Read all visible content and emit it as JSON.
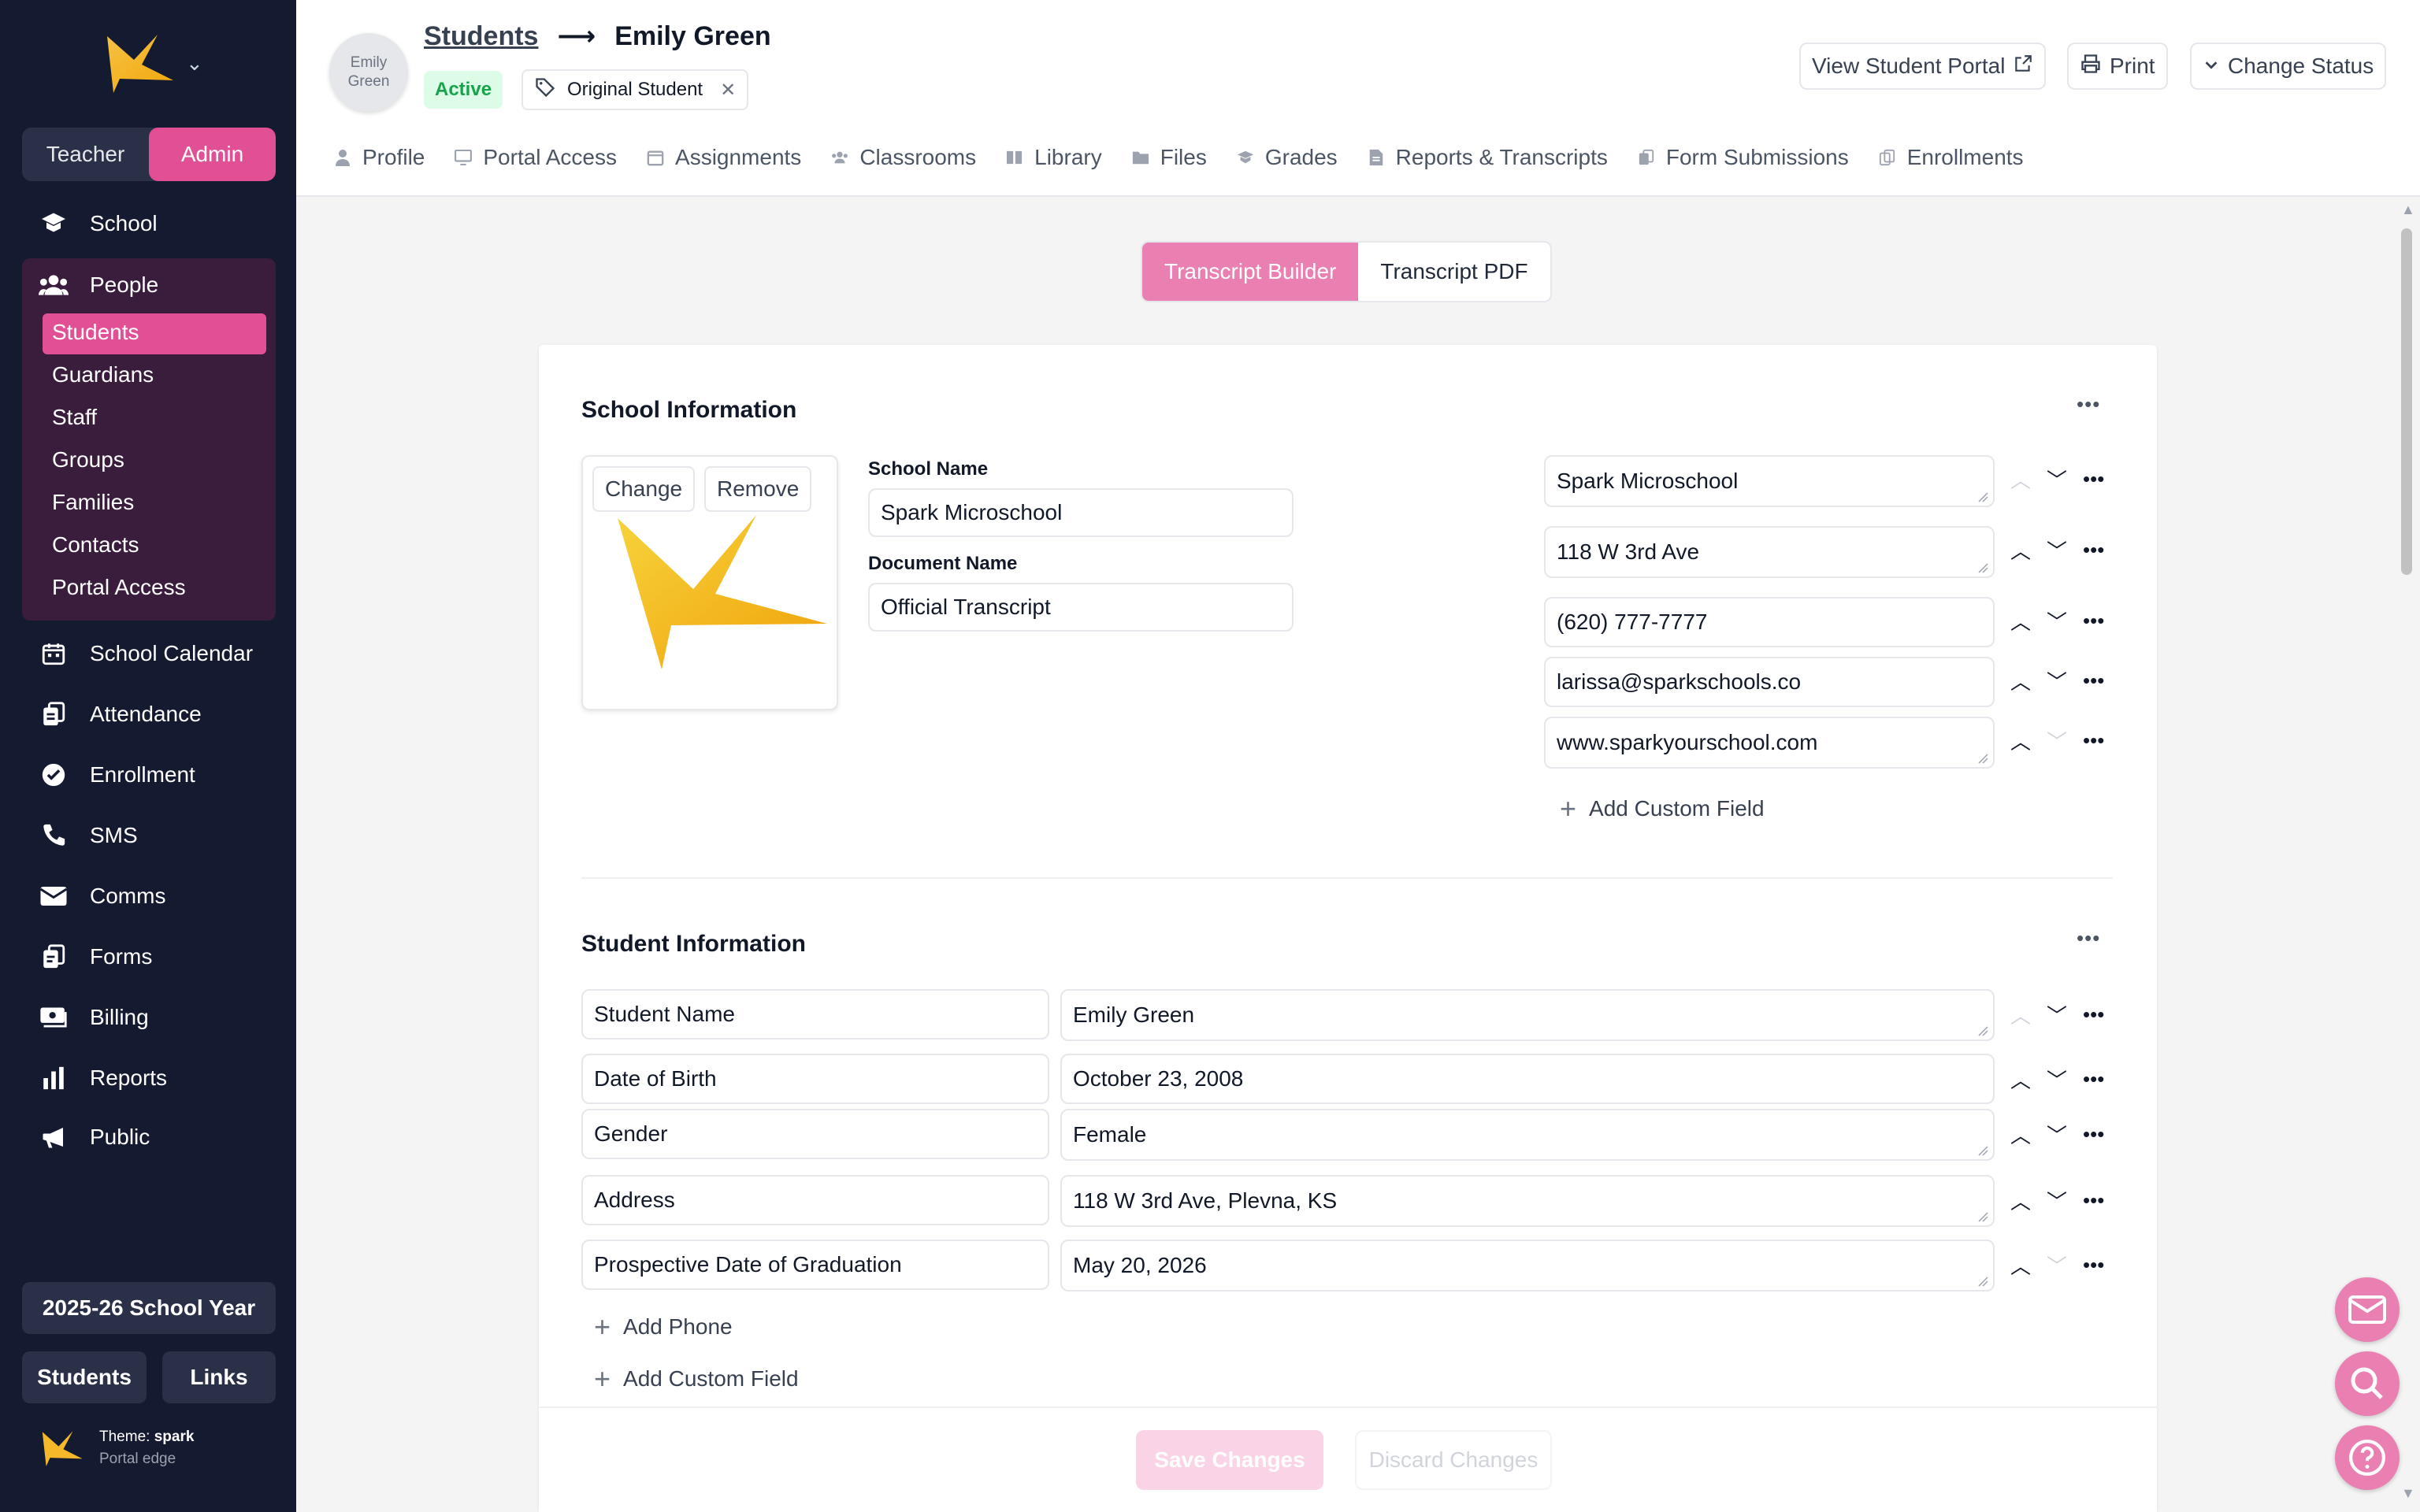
{
  "sidebar": {
    "roles": [
      "Teacher",
      "Admin"
    ],
    "active_role": "Admin",
    "nav_school": "School",
    "nav_people": "People",
    "people_sub": [
      "Students",
      "Guardians",
      "Staff",
      "Groups",
      "Families",
      "Contacts",
      "Portal Access"
    ],
    "nav_bottom": [
      "School Calendar",
      "Attendance",
      "Enrollment",
      "SMS",
      "Comms",
      "Forms",
      "Billing",
      "Reports",
      "Public"
    ],
    "year": "2025-26 School Year",
    "students_btn": "Students",
    "links_btn": "Links",
    "theme_label": "Theme:",
    "theme_name": "spark",
    "theme_sub": "Portal edge"
  },
  "header": {
    "avatar_text": "Emily Green",
    "crumb_link": "Students",
    "crumb_current": "Emily Green",
    "status": "Active",
    "tag": "Original Student",
    "view_portal": "View Student Portal",
    "print": "Print",
    "change_status": "Change Status",
    "tabs": [
      "Profile",
      "Portal Access",
      "Assignments",
      "Classrooms",
      "Library",
      "Files",
      "Grades",
      "Reports & Transcripts",
      "Form Submissions",
      "Enrollments"
    ]
  },
  "segment": {
    "builder": "Transcript Builder",
    "pdf": "Transcript PDF"
  },
  "school_info": {
    "title": "School Information",
    "change": "Change",
    "remove": "Remove",
    "school_name_label": "School Name",
    "school_name": "Spark Microschool",
    "document_name_label": "Document Name",
    "document_name": "Official Transcript",
    "fields": [
      "Spark Microschool",
      "118 W 3rd Ave",
      "(620) 777-7777",
      "larissa@sparkschools.co",
      "www.sparkyourschool.com"
    ],
    "add_custom": "Add Custom Field"
  },
  "student_info": {
    "title": "Student Information",
    "rows": [
      {
        "label": "Student Name",
        "value": "Emily Green"
      },
      {
        "label": "Date of Birth",
        "value": "October 23, 2008"
      },
      {
        "label": "Gender",
        "value": "Female"
      },
      {
        "label": "Address",
        "value": "118 W 3rd Ave, Plevna, KS"
      },
      {
        "label": "Prospective Date of Graduation",
        "value": "May 20, 2026"
      }
    ],
    "add_phone": "Add Phone",
    "add_custom": "Add Custom Field"
  },
  "footer": {
    "save": "Save Changes",
    "discard": "Discard Changes"
  },
  "colors": {
    "accent": "#e14f94",
    "sidebar": "#141a30",
    "people_bg": "#3a1c3d",
    "active_badge": "#16a34a"
  }
}
